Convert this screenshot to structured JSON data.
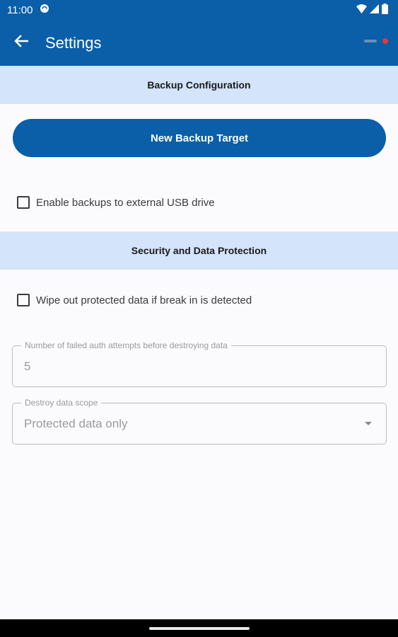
{
  "status_bar": {
    "time": "11:00",
    "icons": [
      "sync-icon",
      "wifi-icon",
      "signal-icon",
      "battery-icon"
    ]
  },
  "app_bar": {
    "title": "Settings",
    "back_icon": "arrow-back-icon"
  },
  "backup_section": {
    "header": "Backup Configuration",
    "new_target_button": "New Backup Target",
    "usb_checkbox": {
      "label": "Enable backups to external USB drive",
      "checked": false
    }
  },
  "security_section": {
    "header": "Security and Data Protection",
    "wipe_checkbox": {
      "label": "Wipe out protected data if break in is detected",
      "checked": false
    },
    "failed_attempts_field": {
      "label": "Number of failed auth attempts before destroying data",
      "value": "5"
    },
    "destroy_scope_field": {
      "label": "Destroy data scope",
      "selected": "Protected data only"
    }
  },
  "colors": {
    "primary": "#0a5fa8",
    "section_bg": "#d3e4fb",
    "background": "#fbfbfe",
    "recording_dot": "#e53935"
  }
}
